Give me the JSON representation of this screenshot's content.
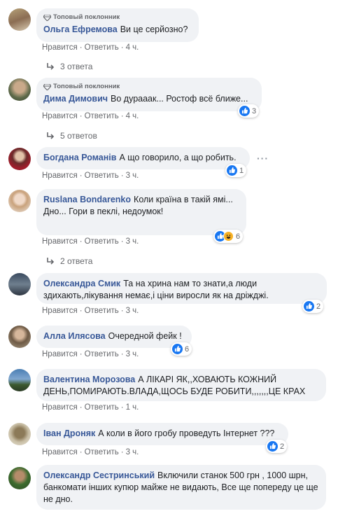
{
  "badge_label": "Топовый поклонник",
  "like_label": "Нравится",
  "reply_label": "Ответить",
  "separator": "·",
  "comments": [
    {
      "author": "Ольга Ефремова",
      "text": "Ви це серйозно?",
      "time": "4 ч.",
      "badge": true,
      "replies": "3 ответа",
      "reaction": null
    },
    {
      "author": "Дима Димович",
      "text": "Во дурааак... Ростоф всё ближе...",
      "time": "4 ч.",
      "badge": true,
      "replies": "5 ответов",
      "reaction": {
        "count": "3",
        "types": [
          "like"
        ]
      }
    },
    {
      "author": "Богдана Романів",
      "text": "А що говорило, а що робить.",
      "time": "3 ч.",
      "badge": false,
      "replies": null,
      "reaction": {
        "count": "1",
        "types": [
          "like"
        ]
      }
    },
    {
      "author": "Ruslana Bondarenko",
      "text": "Коли країна в такій ямі... Дно... Гори в пеклі, недоумок!",
      "time": "3 ч.",
      "badge": false,
      "replies": "2 ответа",
      "reaction": {
        "count": "6",
        "types": [
          "like",
          "haha"
        ]
      }
    },
    {
      "author": "Олександра Смик",
      "text": "Та на хрина нам то знати,а люди здихають,лікування немає,і ціни виросли як на дріжджі.",
      "time": "3 ч.",
      "badge": false,
      "replies": null,
      "reaction": {
        "count": "2",
        "types": [
          "like"
        ]
      }
    },
    {
      "author": "Алла Илясова",
      "text": "Очередной фейк !",
      "time": "3 ч.",
      "badge": false,
      "replies": null,
      "reaction": {
        "count": "6",
        "types": [
          "like"
        ]
      }
    },
    {
      "author": "Валентина Морозова",
      "text": "А ЛІКАРІ ЯК,,ХОВАЮТЬ КОЖНИЙ ДЕНЬ,ПОМИРАЮТЬ.ВЛАДА,ЩОСЬ БУДЕ РОБИТИ,,,,,,,ЦЕ КРАХ",
      "time": "1 ч.",
      "badge": false,
      "replies": null,
      "reaction": null
    },
    {
      "author": "Іван Дроняк",
      "text": "А коли в його гробу проведуть Інтернет ???",
      "time": "3 ч.",
      "badge": false,
      "replies": null,
      "reaction": {
        "count": "2",
        "types": [
          "like"
        ]
      }
    },
    {
      "author": "Олександр Сестринський",
      "text": "Включили станок 500 грн , 1000 шрн, банкомати інших купюр майже не видають, Все ще попереду це ще не дно.",
      "time": "",
      "badge": false,
      "replies": null,
      "reaction": null
    }
  ],
  "colors": {
    "link": "#385898",
    "bubble": "#f0f2f5",
    "meta": "#65676b",
    "like": "#1877f2",
    "haha": "#f7b125"
  },
  "icons": {
    "like": "like-icon",
    "haha": "haha-icon",
    "badge": "diamond-icon",
    "reply_arrow": "reply-arrow-icon",
    "more": "more-options-icon"
  }
}
